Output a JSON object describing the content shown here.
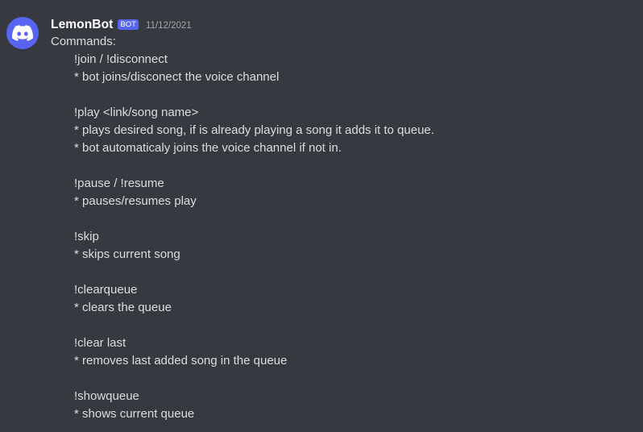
{
  "message": {
    "author": "LemonBot",
    "tag": "BOT",
    "timestamp": "11/12/2021",
    "avatar_icon": "discord-logo-icon",
    "avatar_color": "#5865f2",
    "intro": "Commands:",
    "commands": [
      {
        "command": "!join / !disconnect",
        "description": "* bot joins/disconect the voice channel"
      },
      {
        "command": "!play <link/song name>",
        "description": "* plays desired song, if is already playing a song it adds it to queue.",
        "description_2": "* bot automaticaly joins the voice channel if not in."
      },
      {
        "command": "!pause / !resume",
        "description": "* pauses/resumes play"
      },
      {
        "command": "!skip",
        "description": "* skips current song"
      },
      {
        "command": "!clearqueue",
        "description": "* clears the queue"
      },
      {
        "command": "!clear last",
        "description": "* removes last added song in the queue"
      },
      {
        "command": "!showqueue",
        "description": "* shows current queue"
      }
    ]
  }
}
